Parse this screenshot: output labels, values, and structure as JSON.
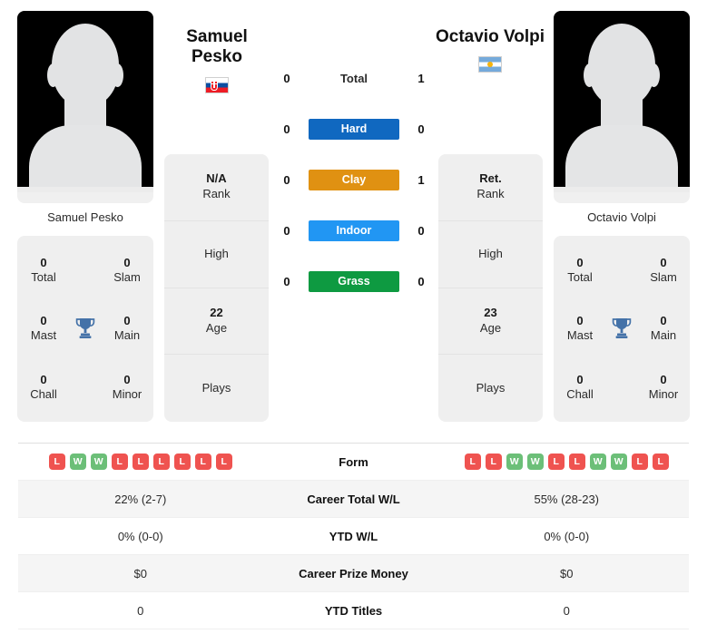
{
  "players": {
    "left": {
      "name": "Samuel Pesko",
      "name_line1": "Samuel",
      "name_line2": "Pesko",
      "flag_icon": "slovakia-flag-icon",
      "photo_caption": "Samuel Pesko",
      "profile": [
        {
          "value": "N/A",
          "label": "Rank"
        },
        {
          "value": "",
          "label": "High"
        },
        {
          "value": "22",
          "label": "Age"
        },
        {
          "value": "",
          "label": "Plays"
        }
      ],
      "titles": [
        {
          "value": "0",
          "label": "Total"
        },
        {
          "value": "0",
          "label": "Slam"
        },
        {
          "value": "0",
          "label": "Mast"
        },
        {
          "value": "0",
          "label": "Main"
        },
        {
          "value": "0",
          "label": "Chall"
        },
        {
          "value": "0",
          "label": "Minor"
        }
      ],
      "form": [
        "L",
        "W",
        "W",
        "L",
        "L",
        "L",
        "L",
        "L",
        "L"
      ],
      "career_total_wl": "22% (2-7)",
      "ytd_wl": "0% (0-0)",
      "career_prize_money": "$0",
      "ytd_titles": "0"
    },
    "right": {
      "name": "Octavio Volpi",
      "name_line1": "Octavio Volpi",
      "name_line2": "",
      "flag_icon": "argentina-flag-icon",
      "photo_caption": "Octavio Volpi",
      "profile": [
        {
          "value": "Ret.",
          "label": "Rank"
        },
        {
          "value": "",
          "label": "High"
        },
        {
          "value": "23",
          "label": "Age"
        },
        {
          "value": "",
          "label": "Plays"
        }
      ],
      "titles": [
        {
          "value": "0",
          "label": "Total"
        },
        {
          "value": "0",
          "label": "Slam"
        },
        {
          "value": "0",
          "label": "Mast"
        },
        {
          "value": "0",
          "label": "Main"
        },
        {
          "value": "0",
          "label": "Chall"
        },
        {
          "value": "0",
          "label": "Minor"
        }
      ],
      "form": [
        "L",
        "L",
        "W",
        "W",
        "L",
        "L",
        "W",
        "W",
        "L",
        "L"
      ],
      "career_total_wl": "55% (28-23)",
      "ytd_wl": "0% (0-0)",
      "career_prize_money": "$0",
      "ytd_titles": "0"
    }
  },
  "surfaces": [
    {
      "label": "Total",
      "left": "0",
      "right": "1",
      "color": "none",
      "plain": true
    },
    {
      "label": "Hard",
      "left": "0",
      "right": "0",
      "color": "#1068c0",
      "plain": false
    },
    {
      "label": "Clay",
      "left": "0",
      "right": "1",
      "color": "#e09112",
      "plain": false
    },
    {
      "label": "Indoor",
      "left": "0",
      "right": "0",
      "color": "#2196f3",
      "plain": false
    },
    {
      "label": "Grass",
      "left": "0",
      "right": "0",
      "color": "#0e9a41",
      "plain": false
    }
  ],
  "table": {
    "rows": [
      {
        "label": "Form",
        "type": "form",
        "left": "",
        "right": ""
      },
      {
        "label": "Career Total W/L",
        "type": "text",
        "left": "22% (2-7)",
        "right": "55% (28-23)"
      },
      {
        "label": "YTD W/L",
        "type": "text",
        "left": "0% (0-0)",
        "right": "0% (0-0)"
      },
      {
        "label": "Career Prize Money",
        "type": "text",
        "left": "$0",
        "right": "$0"
      },
      {
        "label": "YTD Titles",
        "type": "text",
        "left": "0",
        "right": "0"
      }
    ]
  },
  "colors": {
    "win_badge": "#ef5350",
    "loss_badge": "#6cbf78",
    "trophy": "#4472a8",
    "card_bg": "#efefef",
    "row_alt_bg": "#f5f5f5"
  },
  "icons": {
    "trophy": "trophy-icon"
  }
}
